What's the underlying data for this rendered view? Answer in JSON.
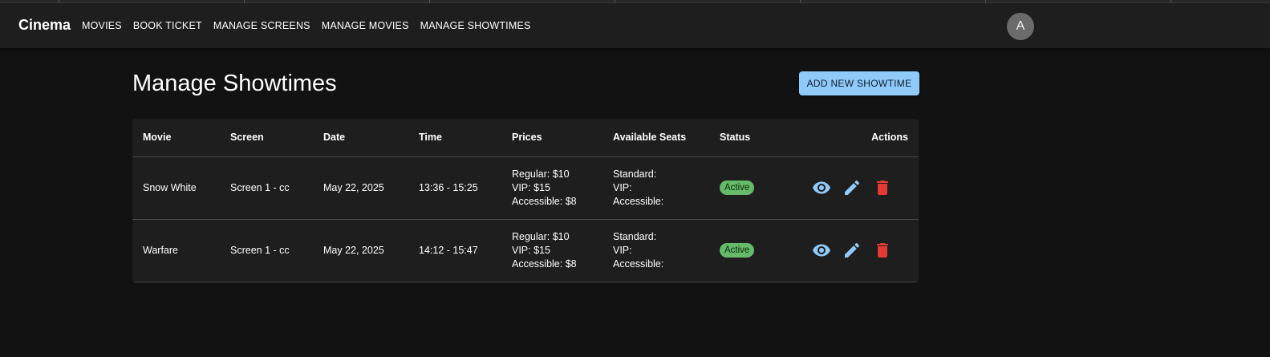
{
  "app": {
    "brand": "Cinema"
  },
  "nav": [
    "MOVIES",
    "BOOK TICKET",
    "MANAGE SCREENS",
    "MANAGE MOVIES",
    "MANAGE SHOWTIMES"
  ],
  "user": {
    "avatar_letter": "A"
  },
  "page": {
    "title": "Manage Showtimes",
    "add_button": "ADD NEW SHOWTIME"
  },
  "table": {
    "headers": [
      "Movie",
      "Screen",
      "Date",
      "Time",
      "Prices",
      "Available Seats",
      "Status",
      "Actions"
    ],
    "rows": [
      {
        "movie": "Snow White",
        "screen": "Screen 1 - cc",
        "date": "May 22, 2025",
        "time": "13:36 - 15:25",
        "prices": [
          "Regular: $10",
          "VIP: $15",
          "Accessible: $8"
        ],
        "seats": [
          "Standard:",
          "VIP:",
          "Accessible:"
        ],
        "status": "Active"
      },
      {
        "movie": "Warfare",
        "screen": "Screen 1 - cc",
        "date": "May 22, 2025",
        "time": "14:12 - 15:47",
        "prices": [
          "Regular: $10",
          "VIP: $15",
          "Accessible: $8"
        ],
        "seats": [
          "Standard:",
          "VIP:",
          "Accessible:"
        ],
        "status": "Active"
      }
    ]
  },
  "colors": {
    "accent": "#90caf9",
    "danger": "#e53935",
    "status_active": "#66bb6a"
  },
  "icons": {
    "view": "eye-icon",
    "edit": "pencil-icon",
    "delete": "trash-icon"
  }
}
